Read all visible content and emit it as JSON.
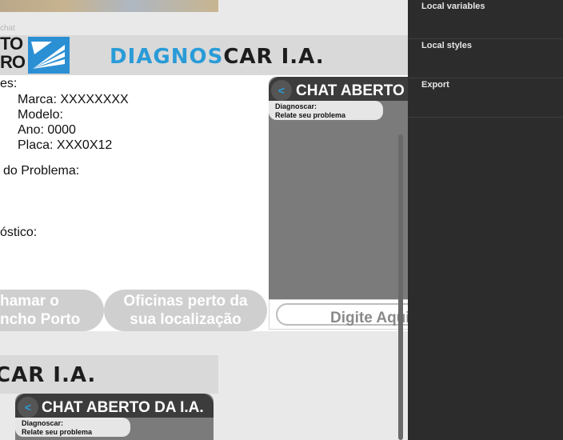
{
  "canvas": {
    "frame_label": "chat",
    "logo_text_line1": "TO",
    "logo_text_line2": "RO",
    "brand_part1": "DIAGNOS",
    "brand_part2": "CAR I.A.",
    "brand2_text": "CAR I.A.",
    "info": {
      "vehicle_heading": "es:",
      "marca": "Marca: XXXXXXXX",
      "modelo": "Modelo:",
      "ano": "Ano: 0000",
      "placa": "Placa: XXX0X12",
      "problem_heading": "do Problema:",
      "diagnosis_heading": "óstico:"
    },
    "chat1": {
      "back_icon": "<",
      "title": "CHAT ABERTO",
      "sender": "Diagnoscar:",
      "message": "Relate seu problema",
      "input_placeholder": "Digite Aqui"
    },
    "chat2": {
      "back_icon": "<",
      "title": "CHAT ABERTO DA I.A.",
      "sender": "Diagnoscar:",
      "message": "Relate seu problema"
    },
    "buttons": {
      "call_line1": "hamar o",
      "call_line2": "ncho Porto",
      "workshops_line1": "Oficinas perto da",
      "workshops_line2": "sua localização"
    },
    "colors": {
      "brand_blue": "#2a9bd7",
      "panel_dark": "#2c2c2c",
      "chat_gray": "#7b7b7b"
    }
  },
  "side_panel": {
    "items": [
      {
        "label": "Local variables"
      },
      {
        "label": "Local styles"
      },
      {
        "label": "Export"
      }
    ]
  }
}
